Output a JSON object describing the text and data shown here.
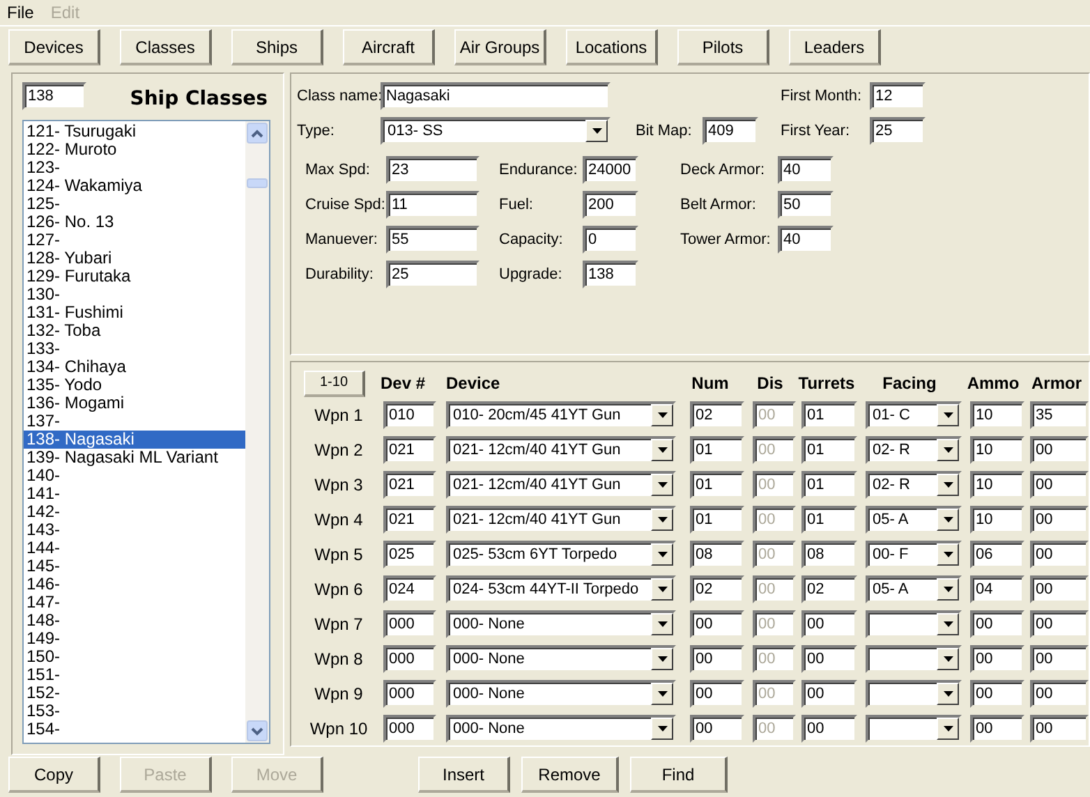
{
  "menu": [
    {
      "label": "File",
      "disabled": false
    },
    {
      "label": "Edit",
      "disabled": true
    }
  ],
  "nav_buttons": [
    "Devices",
    "Classes",
    "Ships",
    "Aircraft",
    "Air Groups",
    "Locations",
    "Pilots",
    "Leaders"
  ],
  "list": {
    "search": "138",
    "title": "Ship Classes",
    "items": [
      {
        "label": "121- Tsurugaki",
        "selected": false
      },
      {
        "label": "122- Muroto",
        "selected": false
      },
      {
        "label": "123-",
        "selected": false
      },
      {
        "label": "124- Wakamiya",
        "selected": false
      },
      {
        "label": "125-",
        "selected": false
      },
      {
        "label": "126- No. 13",
        "selected": false
      },
      {
        "label": "127-",
        "selected": false
      },
      {
        "label": "128- Yubari",
        "selected": false
      },
      {
        "label": "129- Furutaka",
        "selected": false
      },
      {
        "label": "130-",
        "selected": false
      },
      {
        "label": "131- Fushimi",
        "selected": false
      },
      {
        "label": "132- Toba",
        "selected": false
      },
      {
        "label": "133-",
        "selected": false
      },
      {
        "label": "134- Chihaya",
        "selected": false
      },
      {
        "label": "135- Yodo",
        "selected": false
      },
      {
        "label": "136- Mogami",
        "selected": false
      },
      {
        "label": "137-",
        "selected": false
      },
      {
        "label": "138- Nagasaki",
        "selected": true
      },
      {
        "label": "139- Nagasaki ML Variant",
        "selected": false
      },
      {
        "label": "140-",
        "selected": false
      },
      {
        "label": "141-",
        "selected": false
      },
      {
        "label": "142-",
        "selected": false
      },
      {
        "label": "143-",
        "selected": false
      },
      {
        "label": "144-",
        "selected": false
      },
      {
        "label": "145-",
        "selected": false
      },
      {
        "label": "146-",
        "selected": false
      },
      {
        "label": "147-",
        "selected": false
      },
      {
        "label": "148-",
        "selected": false
      },
      {
        "label": "149-",
        "selected": false
      },
      {
        "label": "150-",
        "selected": false
      },
      {
        "label": "151-",
        "selected": false
      },
      {
        "label": "152-",
        "selected": false
      },
      {
        "label": "153-",
        "selected": false
      },
      {
        "label": "154-",
        "selected": false
      }
    ]
  },
  "class_form": {
    "class_name": {
      "label": "Class name:",
      "value": "Nagasaki"
    },
    "first_month": {
      "label": "First Month:",
      "value": "12"
    },
    "type": {
      "label": "Type:",
      "value": "013- SS"
    },
    "bit_map": {
      "label": "Bit Map:",
      "value": "409"
    },
    "first_year": {
      "label": "First Year:",
      "value": "25"
    },
    "stats": [
      [
        {
          "label": "Max Spd:",
          "value": "23"
        },
        {
          "label": "Cruise Spd:",
          "value": "11"
        },
        {
          "label": "Manuever:",
          "value": "55"
        },
        {
          "label": "Durability:",
          "value": "25"
        }
      ],
      [
        {
          "label": "Endurance:",
          "value": "24000"
        },
        {
          "label": "Fuel:",
          "value": "200"
        },
        {
          "label": "Capacity:",
          "value": "0"
        },
        {
          "label": "Upgrade:",
          "value": "138"
        }
      ],
      [
        {
          "label": "Deck Armor:",
          "value": "40"
        },
        {
          "label": "Belt Armor:",
          "value": "50"
        },
        {
          "label": "Tower Armor:",
          "value": "40"
        }
      ]
    ]
  },
  "weapons": {
    "range_button": "1-10",
    "columns": [
      "Dev #",
      "Device",
      "Num",
      "Dis",
      "Turrets",
      "Facing",
      "Ammo",
      "Armor"
    ],
    "rows": [
      {
        "label": "Wpn 1",
        "dev": "010",
        "device": "010- 20cm/45 41YT Gun",
        "num": "02",
        "dis": "00",
        "dis_disabled": true,
        "turrets": "01",
        "facing": "01- C",
        "ammo": "10",
        "armor": "35"
      },
      {
        "label": "Wpn 2",
        "dev": "021",
        "device": "021- 12cm/40 41YT Gun",
        "num": "01",
        "dis": "00",
        "dis_disabled": true,
        "turrets": "01",
        "facing": "02- R",
        "ammo": "10",
        "armor": "00"
      },
      {
        "label": "Wpn 3",
        "dev": "021",
        "device": "021- 12cm/40 41YT Gun",
        "num": "01",
        "dis": "00",
        "dis_disabled": true,
        "turrets": "01",
        "facing": "02- R",
        "ammo": "10",
        "armor": "00"
      },
      {
        "label": "Wpn 4",
        "dev": "021",
        "device": "021- 12cm/40 41YT Gun",
        "num": "01",
        "dis": "00",
        "dis_disabled": true,
        "turrets": "01",
        "facing": "05- A",
        "ammo": "10",
        "armor": "00"
      },
      {
        "label": "Wpn 5",
        "dev": "025",
        "device": "025- 53cm 6YT Torpedo",
        "num": "08",
        "dis": "00",
        "dis_disabled": true,
        "turrets": "08",
        "facing": "00- F",
        "ammo": "06",
        "armor": "00"
      },
      {
        "label": "Wpn 6",
        "dev": "024",
        "device": "024- 53cm 44YT-II Torpedo",
        "num": "02",
        "dis": "00",
        "dis_disabled": true,
        "turrets": "02",
        "facing": "05- A",
        "ammo": "04",
        "armor": "00"
      },
      {
        "label": "Wpn 7",
        "dev": "000",
        "device": "000- None",
        "num": "00",
        "dis": "00",
        "dis_disabled": true,
        "turrets": "00",
        "ammo": "00",
        "armor": "00"
      },
      {
        "label": "Wpn 8",
        "dev": "000",
        "device": "000- None",
        "num": "00",
        "dis": "00",
        "dis_disabled": true,
        "turrets": "00",
        "ammo": "00",
        "armor": "00"
      },
      {
        "label": "Wpn 9",
        "dev": "000",
        "device": "000- None",
        "num": "00",
        "dis": "00",
        "dis_disabled": true,
        "turrets": "00",
        "ammo": "00",
        "armor": "00"
      },
      {
        "label": "Wpn 10",
        "dev": "000",
        "device": "000- None",
        "num": "00",
        "dis": "00",
        "dis_disabled": true,
        "turrets": "00",
        "ammo": "00",
        "armor": "00"
      }
    ]
  },
  "actions": [
    {
      "label": "Copy",
      "disabled": false
    },
    {
      "label": "Paste",
      "disabled": true
    },
    {
      "label": "Move",
      "disabled": true
    },
    {
      "label": "Insert",
      "disabled": false
    },
    {
      "label": "Remove",
      "disabled": false
    },
    {
      "label": "Find",
      "disabled": false
    }
  ]
}
